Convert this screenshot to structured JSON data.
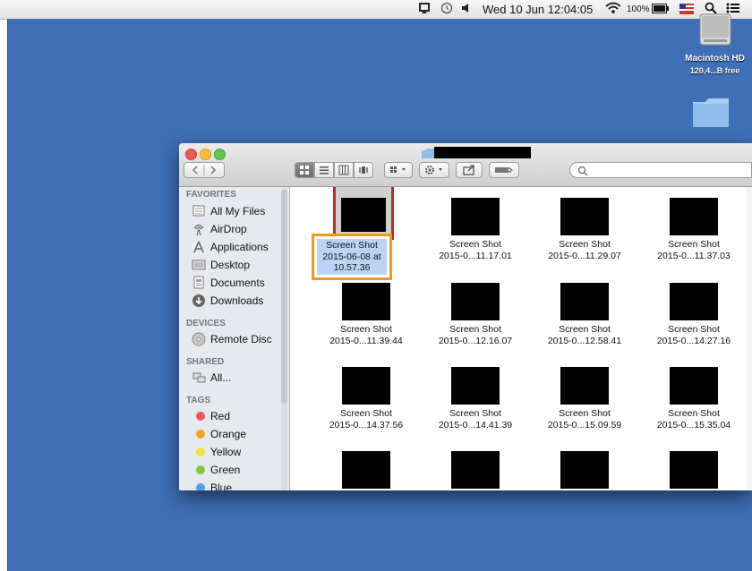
{
  "menubar": {
    "clock": "Wed 10 Jun  12:04:05",
    "battery": "100%",
    "icons": [
      "airplay-icon",
      "time-machine-icon",
      "volume-icon",
      "wifi-icon",
      "battery-icon",
      "flag-icon",
      "spotlight-icon",
      "notification-center-icon"
    ]
  },
  "desktop": {
    "hd_label": "Macintosh HD",
    "hd_sub": "120,4...B free"
  },
  "window": {
    "search_placeholder": "",
    "sidebar": {
      "favorites_head": "FAVORITES",
      "favorites": [
        {
          "label": "All My Files",
          "icon": "all-files-icon"
        },
        {
          "label": "AirDrop",
          "icon": "airdrop-icon"
        },
        {
          "label": "Applications",
          "icon": "applications-icon"
        },
        {
          "label": "Desktop",
          "icon": "desktop-icon"
        },
        {
          "label": "Documents",
          "icon": "documents-icon"
        },
        {
          "label": "Downloads",
          "icon": "downloads-icon"
        }
      ],
      "devices_head": "DEVICES",
      "devices": [
        {
          "label": "Remote Disc",
          "icon": "remote-disc-icon"
        }
      ],
      "shared_head": "SHARED",
      "shared": [
        {
          "label": "All...",
          "icon": "network-icon"
        }
      ],
      "tags_head": "TAGS",
      "tags": [
        {
          "label": "Red",
          "color": "#e8585a"
        },
        {
          "label": "Orange",
          "color": "#f5a623"
        },
        {
          "label": "Yellow",
          "color": "#f4e13a"
        },
        {
          "label": "Green",
          "color": "#7ccb3a"
        },
        {
          "label": "Blue",
          "color": "#56a0e8"
        }
      ]
    },
    "files": [
      {
        "line1": "Screen Shot",
        "line2": "2015-06-08 at",
        "line3": "10.57.36",
        "selected": true
      },
      {
        "line1": "Screen Shot",
        "line2": "2015-0...11.17.01"
      },
      {
        "line1": "Screen Shot",
        "line2": "2015-0...11.29.07"
      },
      {
        "line1": "Screen Shot",
        "line2": "2015-0...11.37.03"
      },
      {
        "line1": "Screen Shot",
        "line2": "2015-0...11.39.44"
      },
      {
        "line1": "Screen Shot",
        "line2": "2015-0...12.16.07"
      },
      {
        "line1": "Screen Shot",
        "line2": "2015-0...12.58.41"
      },
      {
        "line1": "Screen Shot",
        "line2": "2015-0...14.27.16"
      },
      {
        "line1": "Screen Shot",
        "line2": "2015-0...14.37.56"
      },
      {
        "line1": "Screen Shot",
        "line2": "2015-0...14.41.39"
      },
      {
        "line1": "Screen Shot",
        "line2": "2015-0...15.09.59"
      },
      {
        "line1": "Screen Shot",
        "line2": "2015-0...15.35.04"
      },
      {
        "line1": "",
        "line2": ""
      },
      {
        "line1": "",
        "line2": ""
      },
      {
        "line1": "",
        "line2": ""
      },
      {
        "line1": "",
        "line2": ""
      }
    ]
  },
  "colors": {
    "desktop": "#3f6fb6",
    "thumb_highlight": "#a83224",
    "caption_highlight": "#f39a1e",
    "selection": "#bcd4f4"
  }
}
